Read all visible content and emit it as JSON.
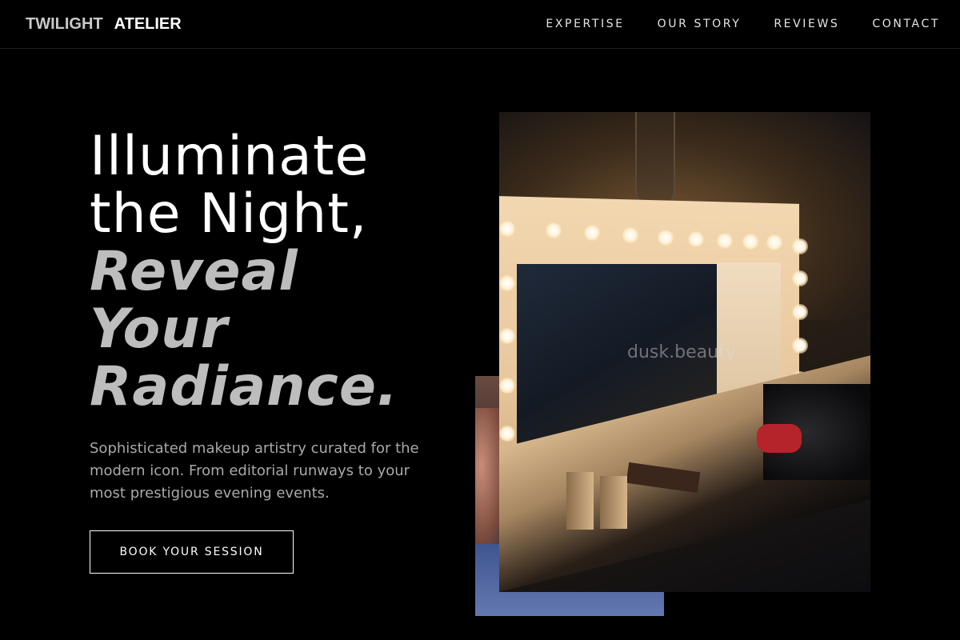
{
  "brand": {
    "word1": "TWILIGHT",
    "word2": "ATELIER"
  },
  "nav": {
    "links": [
      "EXPERTISE",
      "OUR STORY",
      "REVIEWS",
      "CONTACT"
    ]
  },
  "hero": {
    "title_line1": "Illuminate",
    "title_line2": "the Night,",
    "accent_line1": "Reveal",
    "accent_line2": "Your",
    "accent_line3": "Radiance.",
    "subtitle": "Sophisticated makeup artistry curated for the modern icon. From editorial runways to your most prestigious evening events.",
    "cta_label": "BOOK YOUR SESSION"
  },
  "gallery": {
    "watermark": "dusk.beauty"
  },
  "colors": {
    "background": "#000000",
    "text": "#ffffff",
    "accent_text": "#bdbdbd",
    "muted_text": "#a9a9ad",
    "divider": "#1f1f1f"
  }
}
